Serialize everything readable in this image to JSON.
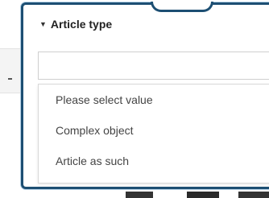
{
  "section": {
    "title": "Article type"
  },
  "select": {
    "value": ""
  },
  "dropdown": {
    "options": [
      "Please select value",
      "Complex object",
      "Article as such"
    ]
  },
  "colors": {
    "callout_border": "#1d4f73",
    "text": "#444444"
  }
}
